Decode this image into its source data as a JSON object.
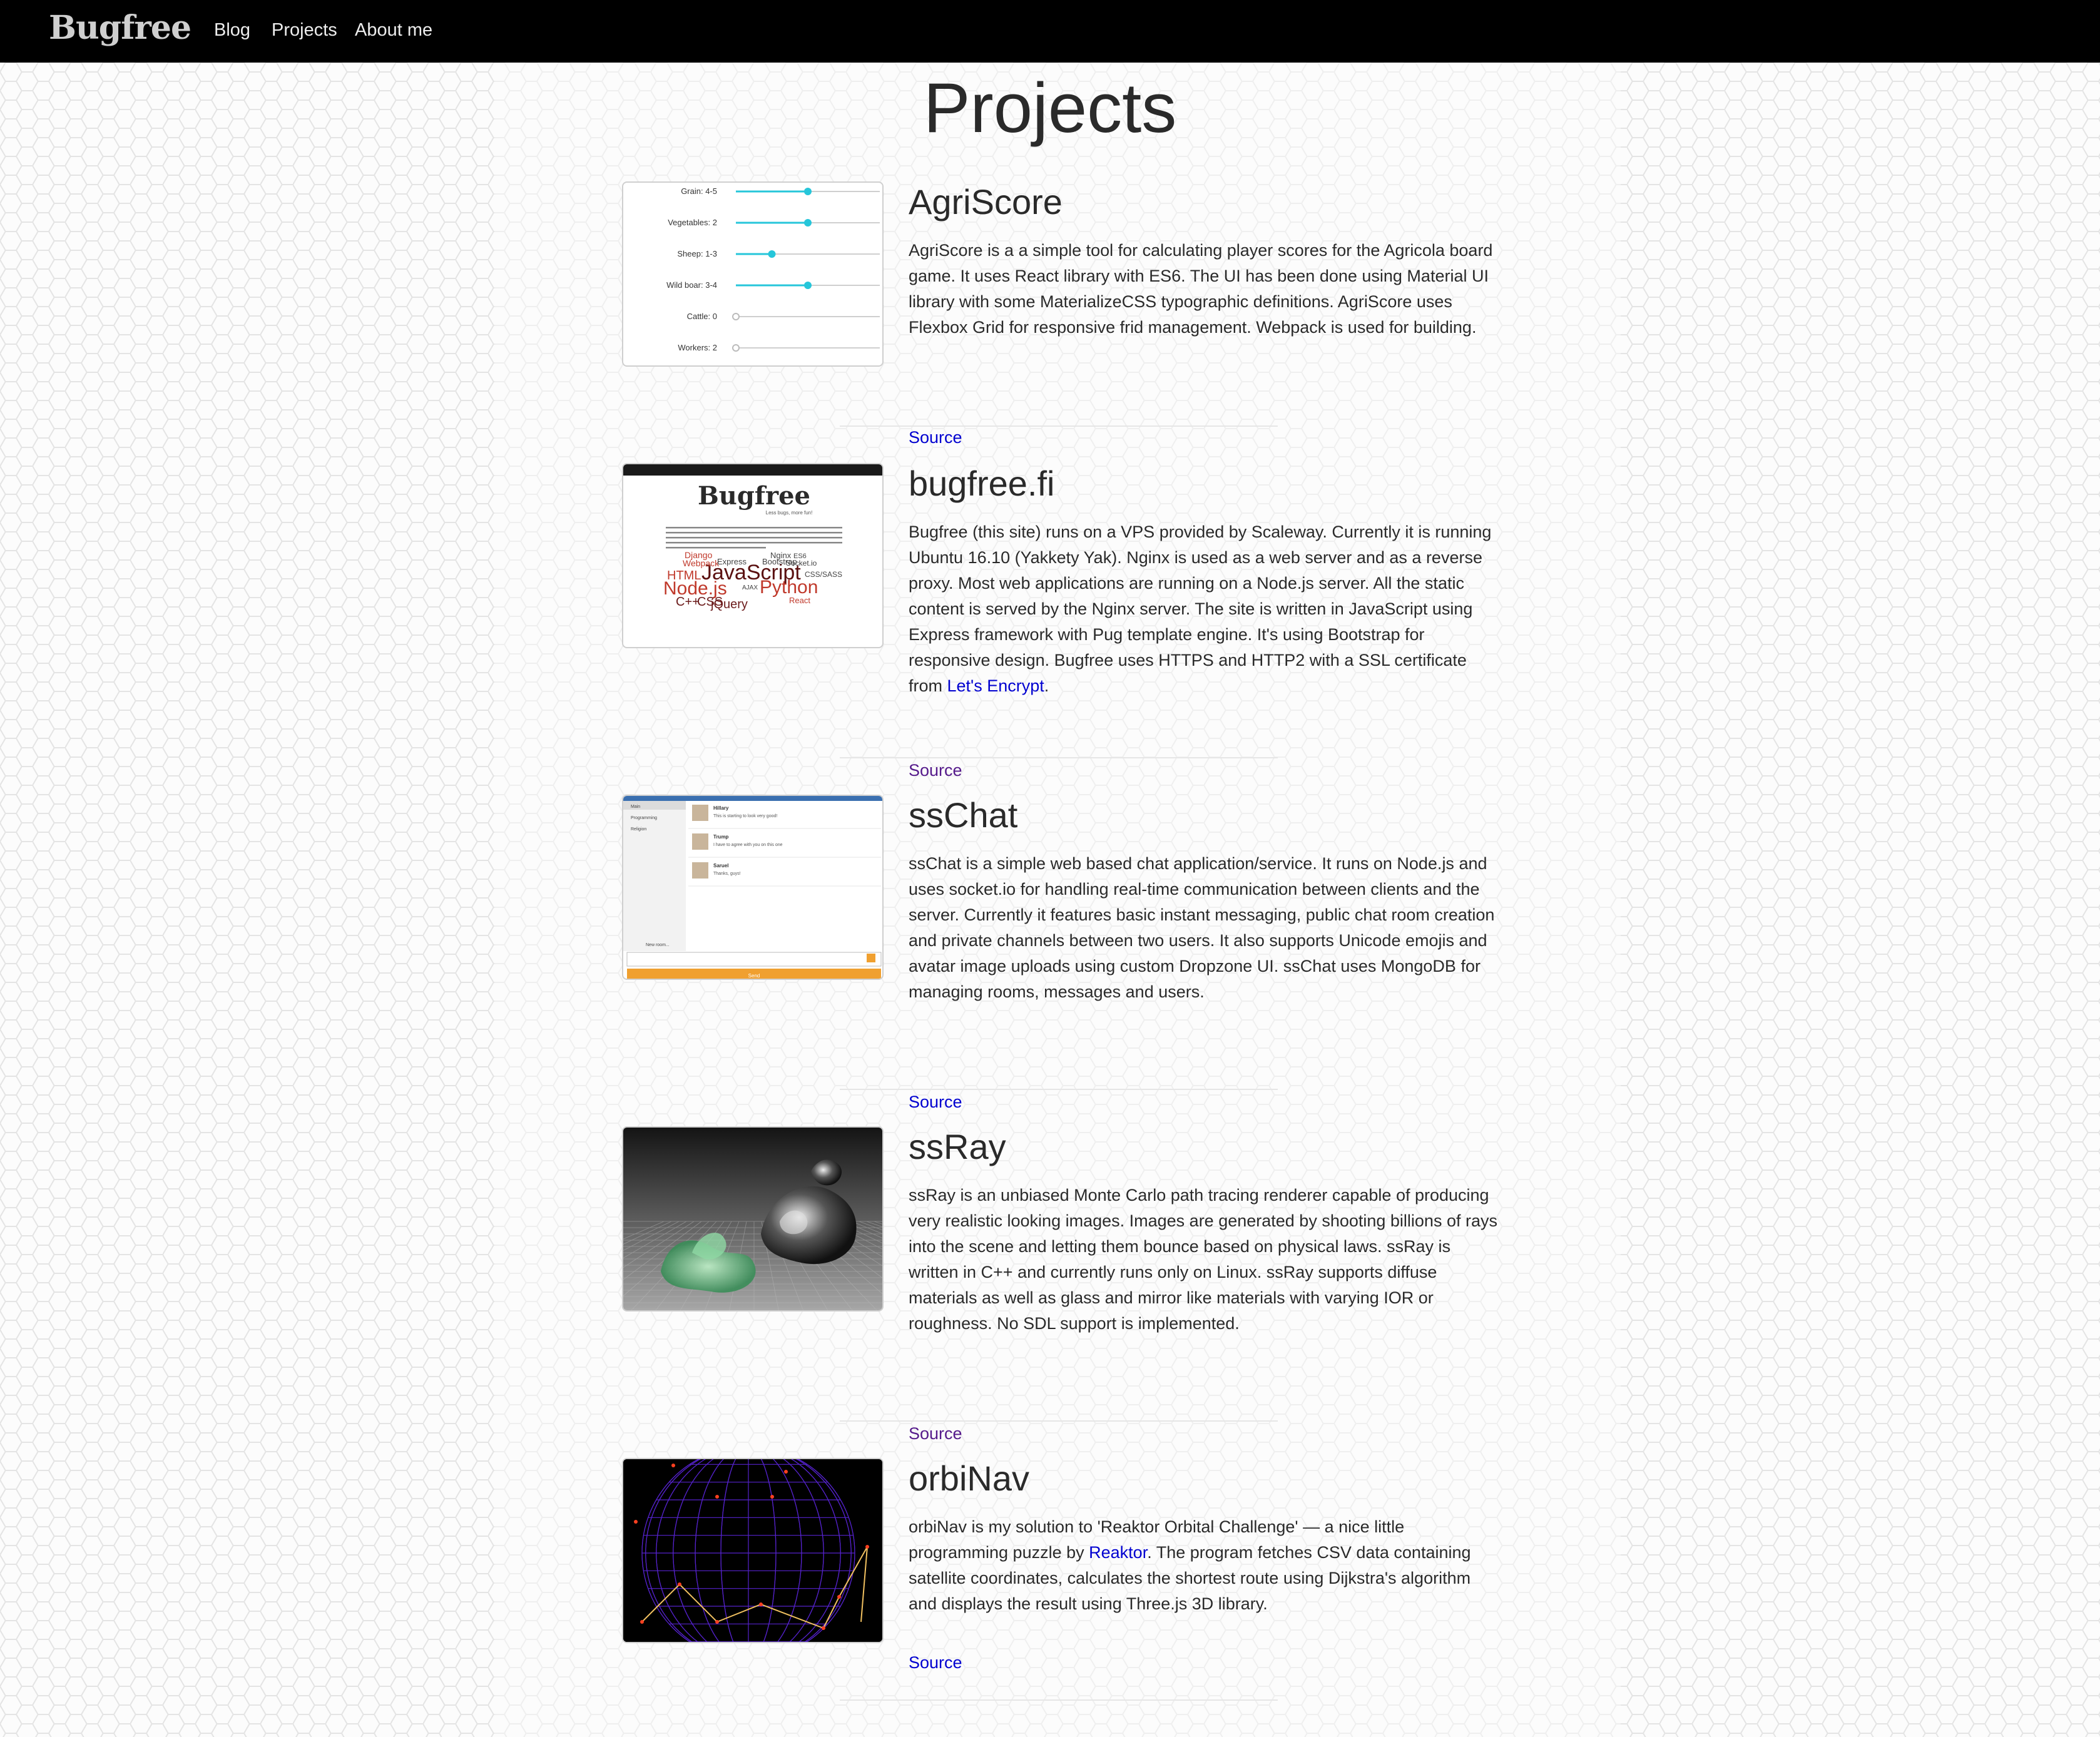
{
  "nav": {
    "brand": "Bugfree",
    "links": [
      "Blog",
      "Projects",
      "About me"
    ]
  },
  "page": {
    "title": "Projects"
  },
  "projects": [
    {
      "title": "AgriScore",
      "desc": [
        "AgriScore is a a simple tool for calculating player scores for the Agricola board game. It uses React library with ES6. The UI has been done using Material UI library with some MaterializeCSS typographic definitions. AgriScore uses Flexbox Grid for responsive frid management. Webpack is used for building."
      ],
      "source": "Source",
      "thumb": {
        "sliders": [
          {
            "label": "Grain:",
            "value": "4-5",
            "level": 0.5
          },
          {
            "label": "Vegetables:",
            "value": "2",
            "level": 0.5
          },
          {
            "label": "Sheep:",
            "value": "1-3",
            "level": 0.25
          },
          {
            "label": "Wild boar:",
            "value": "3-4",
            "level": 0.5
          },
          {
            "label": "Cattle:",
            "value": "0",
            "level": 0
          },
          {
            "label": "Workers:",
            "value": "2",
            "level": 0
          }
        ]
      }
    },
    {
      "title": "bugfree.fi",
      "desc": [
        "Bugfree (this site) runs on a VPS provided by Scaleway. Currently it is running Ubuntu 16.10 (Yakkety Yak). Nginx is used as a web server and as a reverse proxy. Most web applications are running on a Node.js server. All the static content is served by the Nginx server. The site is written in JavaScript using Express framework with Pug template engine. It's using Bootstrap for responsive design. Bugfree uses HTTPS and HTTP2 with a SSL certificate from ",
        "Let's Encrypt",
        "."
      ],
      "source": "Source",
      "thumb": {
        "brand": "Bugfree",
        "tagline": "Less bugs, more fun!",
        "words": [
          "JavaScript",
          "Node.js",
          "Python",
          "HTML",
          "C++",
          "CSS",
          "jQuery",
          "Nginx",
          "Django",
          "CSS/SASS",
          "Socket.io",
          "React",
          "ES6",
          "AJAX",
          "Bootstrap",
          "Webpack",
          "Express"
        ]
      }
    },
    {
      "title": "ssChat",
      "desc": [
        "ssChat is a simple web based chat application/service. It runs on Node.js and uses socket.io for handling real-time communication between clients and the server. Currently it features basic instant messaging, public chat room creation and private channels between two users. It also supports Unicode emojis and avatar image uploads using custom Dropzone UI. ssChat uses MongoDB for managing rooms, messages and users."
      ],
      "source": "Source",
      "thumb": {
        "rooms": [
          "Main",
          "Programming",
          "Religion"
        ],
        "new_room": "New room...",
        "send": "Send",
        "messages": [
          {
            "user": "Hillary",
            "text": "This is starting to look very good!"
          },
          {
            "user": "Trump",
            "text": "I have to agree with you on this one"
          },
          {
            "user": "Saruel",
            "text": "Thanks, guys!"
          }
        ]
      }
    },
    {
      "title": "ssRay",
      "desc": [
        "ssRay is an unbiased Monte Carlo path tracing renderer capable of producing very realistic looking images. Images are generated by shooting billions of rays into the scene and letting them bounce based on physical laws. ssRay is written in C++ and currently runs only on Linux. ssRay supports diffuse materials as well as glass and mirror like materials with varying IOR or roughness. No SDL support is implemented."
      ],
      "source": "Source"
    },
    {
      "title": "orbiNav",
      "desc": [
        "orbiNav is my solution to 'Reaktor Orbital Challenge' — a nice little programming puzzle by ",
        "Reaktor",
        ". The program fetches CSV data containing satellite coordinates, calculates the shortest route using Dijkstra's algorithm and displays the result using Three.js 3D library."
      ],
      "source": "Source"
    }
  ],
  "colors": {
    "accent": "#26c6da",
    "link": "#0000d0",
    "visited": "#551a8b",
    "navbar": "#000000",
    "orbit_lines": "#5522cc",
    "route": "#f0a030"
  }
}
